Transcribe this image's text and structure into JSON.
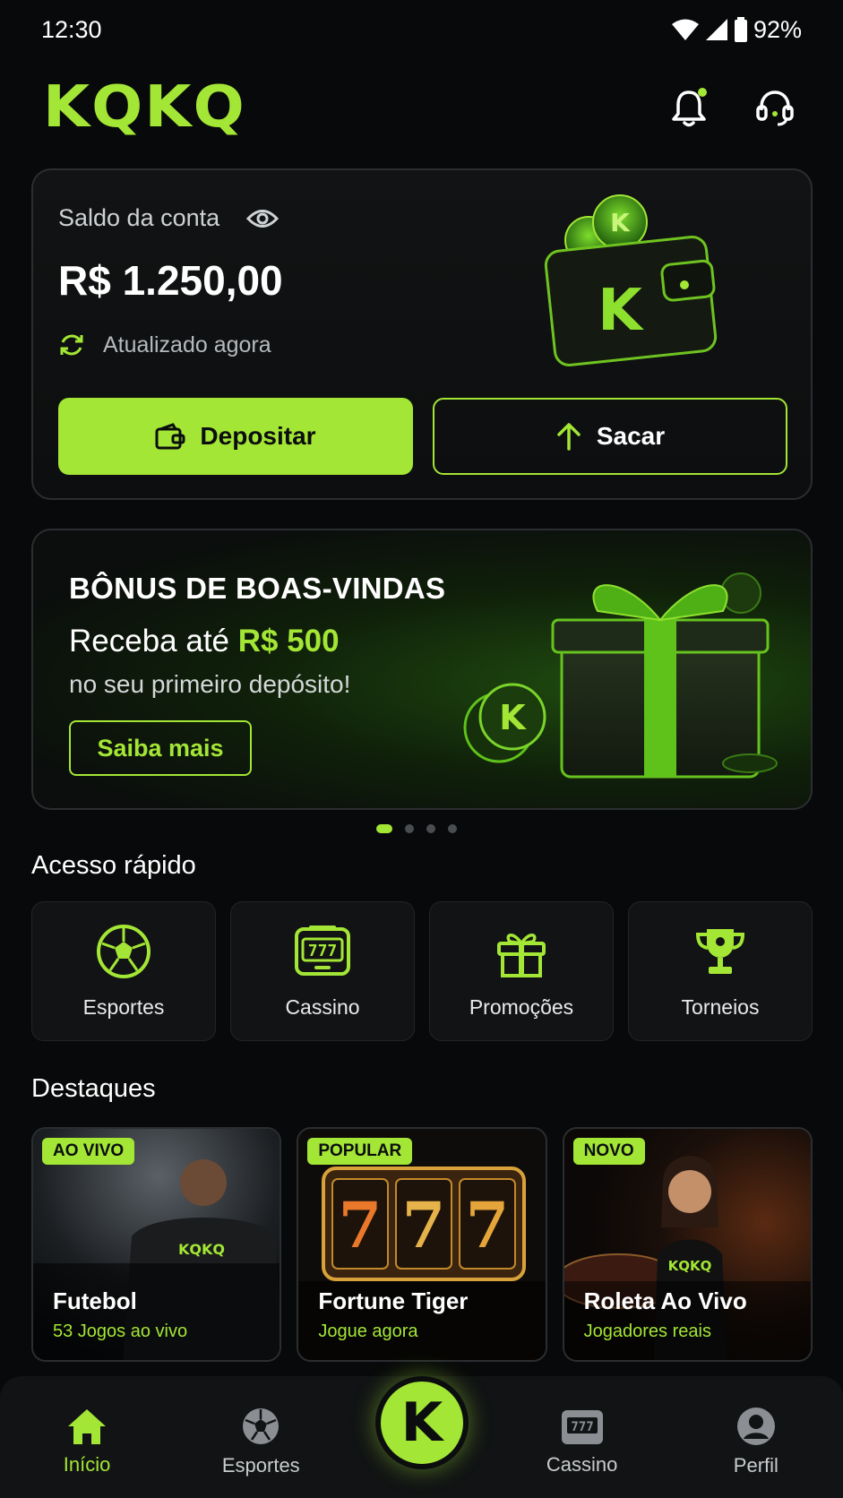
{
  "status": {
    "time": "12:30",
    "battery": "92%"
  },
  "header": {
    "logo": "KQKQ"
  },
  "balance": {
    "label": "Saldo da conta",
    "value": "R$ 1.250,00",
    "updated": "Atualizado agora",
    "deposit_label": "Depositar",
    "withdraw_label": "Sacar"
  },
  "promo": {
    "title": "BÔNUS DE BOAS-VINDAS",
    "sub_prefix": "Receba até ",
    "sub_highlight": "R$ 500",
    "sub2": "no seu primeiro depósito!",
    "button": "Saiba mais",
    "carousel_index": 1,
    "carousel_count": 4
  },
  "quick_access": {
    "title": "Acesso rápido",
    "items": [
      {
        "label": "Esportes",
        "icon": "soccer-ball-icon"
      },
      {
        "label": "Cassino",
        "icon": "slot-machine-icon"
      },
      {
        "label": "Promoções",
        "icon": "gift-icon"
      },
      {
        "label": "Torneios",
        "icon": "trophy-icon"
      }
    ]
  },
  "highlights": {
    "title": "Destaques",
    "cards": [
      {
        "badge": "AO VIVO",
        "title": "Futebol",
        "subtitle": "53 Jogos ao vivo"
      },
      {
        "badge": "POPULAR",
        "title": "Fortune Tiger",
        "subtitle": "Jogue agora"
      },
      {
        "badge": "NOVO",
        "title": "Roleta Ao Vivo",
        "subtitle": "Jogadores reais"
      }
    ]
  },
  "nav": {
    "items": [
      {
        "label": "Início",
        "icon": "home-icon"
      },
      {
        "label": "Esportes",
        "icon": "soccer-ball-icon"
      },
      {
        "label": "Cassino",
        "icon": "slot-machine-icon"
      },
      {
        "label": "Perfil",
        "icon": "user-icon"
      }
    ],
    "center_label": "K"
  },
  "colors": {
    "accent": "#a3e635",
    "background": "#08090a",
    "card": "#111314"
  }
}
